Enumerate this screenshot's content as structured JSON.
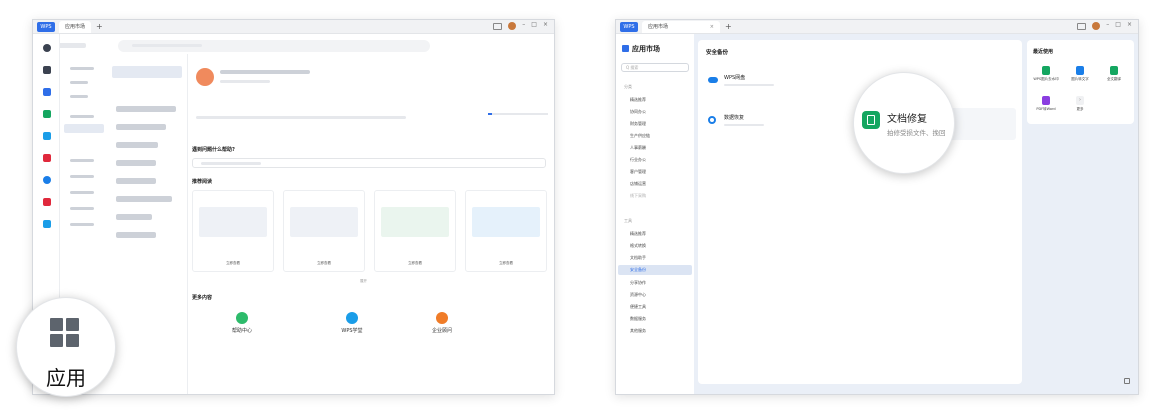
{
  "left_window": {
    "tab_app": "WPS",
    "tab_title": "应用市场",
    "new_tab": "+",
    "section_help": "遇到问题什么帮助?",
    "section_reading": "推荐阅读",
    "section_more": "更多内容",
    "more_items": [
      {
        "title": "帮助中心",
        "color": "#2dbb6b"
      },
      {
        "title": "WPS学堂",
        "color": "#1a9de8"
      },
      {
        "title": "企业顾问",
        "color": "#f07c28"
      }
    ],
    "card_link": "立即查看",
    "more_link": "展开"
  },
  "left_magnifier": {
    "label": "应用",
    "icon": "grid-apps-icon"
  },
  "right_window": {
    "tab_app": "WPS",
    "tab_title": "应用市场",
    "tab_close": "×",
    "new_tab": "+",
    "sidebar_title": "应用市场",
    "sidebar_search_placeholder": "Q 搜索",
    "sidebar_groups": [
      {
        "label": "分类",
        "items": [
          "精选推荐",
          "协同办公",
          "财务管理",
          "生产供应链",
          "人事薪酬",
          "行业办公",
          "客户管理",
          "店铺运营",
          "线下采购"
        ]
      },
      {
        "label": "工具",
        "items": [
          "精选推荐",
          "格式转换",
          "文档助手",
          "安全备份",
          "分享协作",
          "资源中心",
          "便捷工具",
          "数据服务",
          "其他服务"
        ]
      }
    ],
    "active_item": "安全备份",
    "content_title": "安全备份",
    "content_items": [
      {
        "title": "WPS网盘",
        "icon": "cloud-icon"
      },
      {
        "title": "数据恢复",
        "icon": "recover-icon"
      }
    ],
    "recent_title": "最近使用",
    "recent_items": [
      {
        "label": "WPS图片去水印",
        "color": "#14a660"
      },
      {
        "label": "图片转文字",
        "color": "#1a7ee8"
      },
      {
        "label": "全文翻译",
        "color": "#14a660"
      },
      {
        "label": "PDF转Word",
        "color": "#8a3de0"
      },
      {
        "label": "更多",
        "color": "#f0f1f3"
      }
    ]
  },
  "right_magnifier": {
    "title": "文档修复",
    "desc": "拍修受损文件、挽回",
    "icon": "doc-repair-icon",
    "icon_color": "#14a660"
  }
}
